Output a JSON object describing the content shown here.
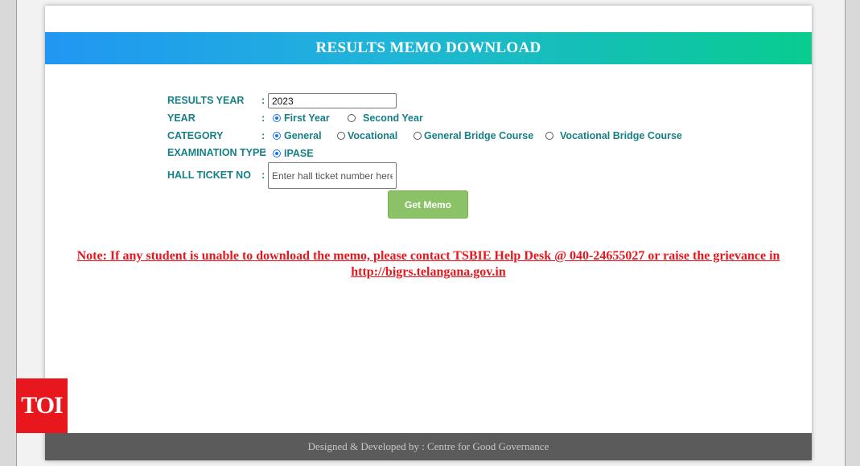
{
  "banner": {
    "title": "RESULTS MEMO DOWNLOAD"
  },
  "form": {
    "results_year": {
      "label": "RESULTS YEAR",
      "colon": ":",
      "value": "2023"
    },
    "year": {
      "label": "YEAR",
      "colon": ":",
      "options": [
        {
          "label": "First Year",
          "checked": true
        },
        {
          "label": "Second Year",
          "checked": false
        }
      ]
    },
    "category": {
      "label": "CATEGORY",
      "colon": ":",
      "options": [
        {
          "label": "General",
          "checked": true
        },
        {
          "label": "Vocational",
          "checked": false
        },
        {
          "label": "General Bridge Course",
          "checked": false
        },
        {
          "label": "Vocational Bridge Course",
          "checked": false
        }
      ]
    },
    "examination_type": {
      "label": "EXAMINATION TYPE",
      "colon": ":",
      "options": [
        {
          "label": "IPASE",
          "checked": true
        }
      ]
    },
    "hall_ticket": {
      "label": "HALL TICKET NO",
      "colon": ":",
      "placeholder": "Enter hall ticket number here"
    },
    "submit_label": "Get Memo"
  },
  "note": {
    "text": "Note: If any student is unable to download the memo, please contact TSBIE Help Desk @ 040-24655027 or raise the grievance in",
    "link": "http://bigrs.telangana.gov.in"
  },
  "footer": {
    "text": "Designed & Developed by : Centre for Good Governance"
  },
  "watermark": {
    "text": "TOI"
  },
  "colors": {
    "accent_teal": "#167f86",
    "banner_start": "#2196f3",
    "banner_end": "#08cc8f",
    "button": "#8bc267",
    "note_red": "#e8171d",
    "footer_bg": "#5b5b5c"
  }
}
